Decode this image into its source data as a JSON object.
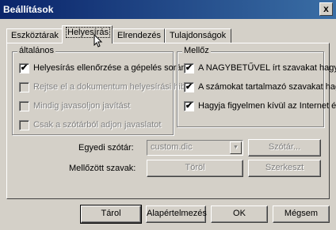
{
  "window": {
    "title": "Beállítások",
    "close_label": "x"
  },
  "tabs": [
    {
      "label": "Eszköztárak"
    },
    {
      "label": "Helyesírás"
    },
    {
      "label": "Elrendezés"
    },
    {
      "label": "Tulajdonságok"
    }
  ],
  "general": {
    "title": "általános",
    "items": [
      {
        "label": "Helyesírás ellenőrzése a gépelés során",
        "checked": true,
        "enabled": true
      },
      {
        "label": "Rejtse el a dokumentum helyesírási hib",
        "checked": false,
        "enabled": false
      },
      {
        "label": "Mindig javasoljon javítást",
        "checked": false,
        "enabled": false
      },
      {
        "label": "Csak a szótárból adjon javaslatot",
        "checked": false,
        "enabled": false
      }
    ]
  },
  "ignore": {
    "title": "Mellőz",
    "items": [
      {
        "label": "A NAGYBETŰVEL írt szavakat hagyja",
        "checked": true
      },
      {
        "label": "A számokat tartalmazó szavakat hagyja",
        "checked": true
      },
      {
        "label": "Hagyja figyelmen kívül az Internet és fá",
        "checked": true
      }
    ]
  },
  "dictionary": {
    "custom_label": "Egyedi szótár:",
    "custom_value": "custom.dic",
    "dictionary_button": "Szótár...",
    "ignored_label": "Mellőzött szavak:",
    "clear_button": "Töröl",
    "edit_button": "Szerkeszt"
  },
  "footer": {
    "ok": "Tárol",
    "defaults": "Alapértelmezés",
    "apply": "OK",
    "cancel": "Mégsem"
  },
  "check_mark": "✔"
}
